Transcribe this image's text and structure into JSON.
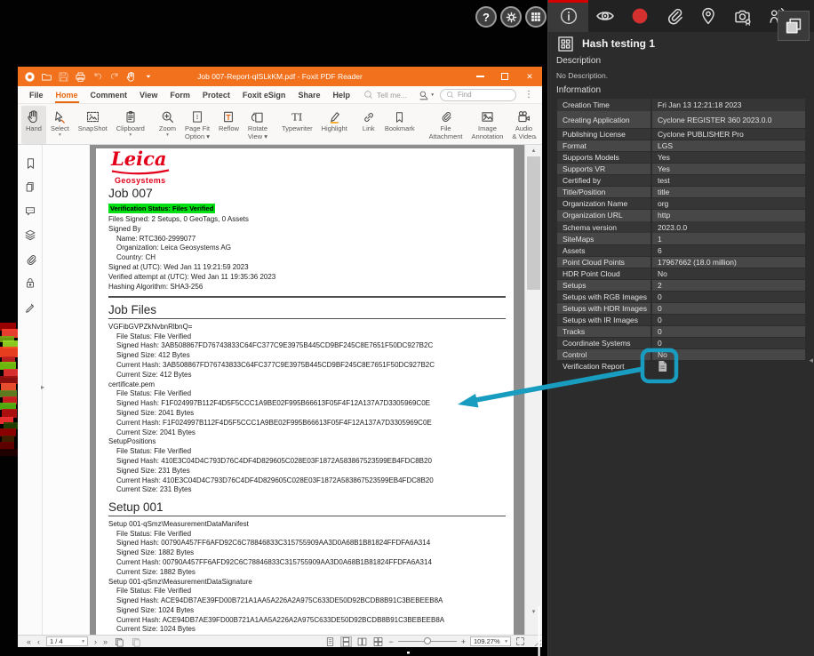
{
  "desktop": {
    "help_glyph": "?"
  },
  "titlebar": {
    "title": "Job 007-Report-qISLkKM.pdf - Foxit PDF Reader",
    "quick_icons": [
      "foxit-logo",
      "folder-open-icon",
      "save-icon",
      "print-icon",
      "undo-icon",
      "redo-icon",
      "hand-ink-icon",
      "caret-down-icon"
    ]
  },
  "menubar": {
    "items": [
      "File",
      "Home",
      "Comment",
      "View",
      "Form",
      "Protect",
      "Foxit eSign",
      "Share",
      "Help"
    ],
    "active": "Home",
    "tell_me": "Tell me...",
    "find_placeholder": "Find"
  },
  "toolbar": {
    "groups": [
      [
        {
          "label": "Hand",
          "icon": "hand-icon",
          "selected": true
        },
        {
          "label": "Select",
          "icon": "select-icon",
          "caret": true
        },
        {
          "label": "SnapShot",
          "icon": "snapshot-icon"
        },
        {
          "label": "Clipboard",
          "icon": "clipboard-icon",
          "caret": true
        }
      ],
      [
        {
          "label": "Zoom",
          "icon": "zoom-icon",
          "caret": true
        },
        {
          "label": "Page Fit\nOption ▾",
          "icon": "pagefit-icon",
          "twoline": true
        },
        {
          "label": "Reflow",
          "icon": "reflow-icon"
        },
        {
          "label": "Rotate\nView ▾",
          "icon": "rotate-icon",
          "twoline": true
        }
      ],
      [
        {
          "label": "Typewriter",
          "icon": "typewriter-icon"
        },
        {
          "label": "Highlight",
          "icon": "highlight-icon"
        }
      ],
      [
        {
          "label": "Link",
          "icon": "link-icon"
        },
        {
          "label": "Bookmark",
          "icon": "bookmark-icon"
        }
      ],
      [
        {
          "label": "File\nAttachment",
          "icon": "attachment-icon",
          "twoline": true
        },
        {
          "label": "Image\nAnnotation",
          "icon": "image-annotation-icon",
          "twoline": true
        },
        {
          "label": "Audio\n& Video",
          "icon": "audio-video-icon",
          "twoline": true
        }
      ]
    ]
  },
  "sidebar_icons": [
    "bookmark-icon",
    "pages-icon",
    "comments-icon",
    "layers-icon",
    "attachment-icon",
    "security-icon",
    "signature-icon"
  ],
  "pdf": {
    "logo_title": "Leica",
    "logo_subtitle": "Geosystems",
    "blocks": [
      [
        "h1",
        "Job 007"
      ],
      [
        "hl",
        "Verification Status: Files Verified"
      ],
      [
        "ln",
        "Files Signed: 2 Setups, 0 GeoTags, 0 Assets"
      ],
      [
        "ln",
        "Signed By"
      ],
      [
        "ln1",
        "Name: RTC360-2999077"
      ],
      [
        "ln1",
        "Organization: Leica Geosystems AG"
      ],
      [
        "ln1",
        "Country: CH"
      ],
      [
        "ln",
        "Signed at (UTC): Wed Jan 11 19:21:59 2023"
      ],
      [
        "ln",
        "Verified attempt at (UTC): Wed Jan 11 19:35:36 2023"
      ],
      [
        "ln",
        "Hashing Algorithm: SHA3-256"
      ],
      [
        "rule",
        ""
      ],
      [
        "h2",
        "Job Files"
      ],
      [
        "rule2",
        ""
      ],
      [
        "ln",
        "VGFibGVPZkNvbnRlbnQ="
      ],
      [
        "ln1",
        "File Status: File Verified"
      ],
      [
        "ln1",
        "Signed Hash: 3AB508867FD76743833C64FC377C9E3975B445CD9BF245C8E7651F50DC927B2C"
      ],
      [
        "ln1",
        "Signed Size: 412 Bytes"
      ],
      [
        "ln1",
        "Current Hash: 3AB508867FD76743833C64FC377C9E3975B445CD9BF245C8E7651F50DC927B2C"
      ],
      [
        "ln1",
        "Current Size: 412 Bytes"
      ],
      [
        "ln",
        "certificate.pem"
      ],
      [
        "ln1",
        "File Status: File Verified"
      ],
      [
        "ln1",
        "Signed Hash: F1F024997B112F4D5F5CCC1A9BE02F995B66613F05F4F12A137A7D3305969C0E"
      ],
      [
        "ln1",
        "Signed Size: 2041 Bytes"
      ],
      [
        "ln1",
        "Current Hash: F1F024997B112F4D5F5CCC1A9BE02F995B66613F05F4F12A137A7D3305969C0E"
      ],
      [
        "ln1",
        "Current Size: 2041 Bytes"
      ],
      [
        "ln",
        "SetupPositions"
      ],
      [
        "ln1",
        "File Status: File Verified"
      ],
      [
        "ln1",
        "Signed Hash: 410E3C04D4C793D76C4DF4D829605C028E03F1872A583867523599EB4FDC8B20"
      ],
      [
        "ln1",
        "Signed Size: 231 Bytes"
      ],
      [
        "ln1",
        "Current Hash: 410E3C04D4C793D76C4DF4D829605C028E03F1872A583867523599EB4FDC8B20"
      ],
      [
        "ln1",
        "Current Size: 231 Bytes"
      ],
      [
        "h2",
        "Setup 001"
      ],
      [
        "rule2",
        ""
      ],
      [
        "ln",
        "Setup 001-qSmz\\MeasurementDataManifest"
      ],
      [
        "ln1",
        "File Status: File Verified"
      ],
      [
        "ln1",
        "Signed Hash: 00790A457FF6AFD92C6C78846833C315755909AA3D0A68B1B81824FFDFA6A314"
      ],
      [
        "ln1",
        "Signed Size: 1882 Bytes"
      ],
      [
        "ln1",
        "Current Hash: 00790A457FF6AFD92C6C78846833C315755909AA3D0A68B1B81824FFDFA6A314"
      ],
      [
        "ln1",
        "Current Size: 1882 Bytes"
      ],
      [
        "ln",
        "Setup 001-qSmz\\MeasurementDataSignature"
      ],
      [
        "ln1",
        "File Status: File Verified"
      ],
      [
        "ln1",
        "Signed Hash: ACE94DB7AE39FD00B721A1AA5A226A2A975C633DE50D92BCDB8B91C3BEBEEB8A"
      ],
      [
        "ln1",
        "Signed Size: 1024 Bytes"
      ],
      [
        "ln1",
        "Current Hash: ACE94DB7AE39FD00B721A1AA5A226A2A975C633DE50D92BCDB8B91C3BEBEEB8A"
      ],
      [
        "ln1",
        "Current Size: 1024 Bytes"
      ]
    ]
  },
  "statusbar": {
    "page_indicator": "1 / 4",
    "zoom_level": "109.27%"
  },
  "panel": {
    "tabs": [
      "info-icon",
      "eye-icon",
      "record-icon",
      "paperclip-icon",
      "pin-icon",
      "camera-icon",
      "person-signal-icon"
    ],
    "selected_tab": "info-icon",
    "panel_toggle_icon": "layers-icon",
    "title": "Hash testing 1",
    "title_icon": "lgs-project-icon",
    "description_label": "Description",
    "no_description": "No Description.",
    "information_label": "Information",
    "rows": [
      [
        "Creation Time",
        "Fri Jan 13 12:21:18 2023"
      ],
      [
        "Creating Application",
        "Cyclone REGISTER 360 2023.0.0"
      ],
      [
        "Publishing License",
        "Cyclone PUBLISHER Pro"
      ],
      [
        "Format",
        "LGS"
      ],
      [
        "Supports Models",
        "Yes"
      ],
      [
        "Supports VR",
        "Yes"
      ],
      [
        "Certified by",
        "test"
      ],
      [
        "Title/Position",
        "title"
      ],
      [
        "Organization Name",
        "org"
      ],
      [
        "Organization URL",
        "http"
      ],
      [
        "Schema version",
        "2023.0.0"
      ],
      [
        "SiteMaps",
        "1"
      ],
      [
        "Assets",
        "6"
      ],
      [
        "Point Cloud Points",
        "17967662 (18.0 million)"
      ],
      [
        "HDR Point Cloud",
        "No"
      ],
      [
        "Setups",
        "2"
      ],
      [
        "Setups with RGB Images",
        "0"
      ],
      [
        "Setups with HDR Images",
        "0"
      ],
      [
        "Setups with IR Images",
        "0"
      ],
      [
        "Tracks",
        "0"
      ],
      [
        "Coordinate Systems",
        "0"
      ],
      [
        "Control",
        "No"
      ],
      [
        "Verification Report",
        ""
      ]
    ],
    "verification_report_icon": "report-document-icon"
  },
  "colors": {
    "accent_orange": "#f2711c",
    "annotation_teal": "#189dc0",
    "tab_indicator_red": "#d40000",
    "record_red": "#d43030",
    "highlight_green": "#00e012",
    "leica_red": "#e2001a"
  }
}
